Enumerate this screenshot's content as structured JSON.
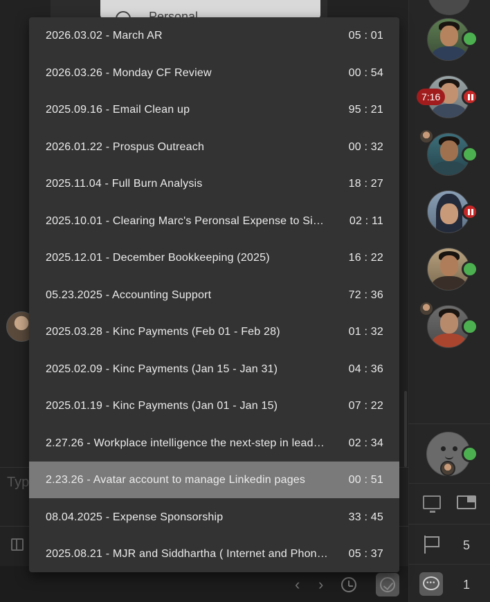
{
  "background": {
    "panel_peek_text": "Personal",
    "input_placeholder": "Type"
  },
  "sidebar": {
    "timer_badge": "7:16",
    "flag_count": "5",
    "chat_count": "1"
  },
  "dropdown": {
    "items": [
      {
        "title": "2026.03.02 - March AR",
        "time": "05 : 01"
      },
      {
        "title": "2026.03.26 - Monday CF Review",
        "time": "00 : 54"
      },
      {
        "title": "2025.09.16 - Email Clean up",
        "time": "95 : 21"
      },
      {
        "title": "2026.01.22 - Prospus Outreach",
        "time": "00 : 32"
      },
      {
        "title": "2025.11.04 - Full Burn Analysis",
        "time": "18 : 27"
      },
      {
        "title": "2025.10.01 - Clearing Marc's Peronsal Expense to Si…",
        "time": "02 : 11"
      },
      {
        "title": "2025.12.01 - December Bookkeeping (2025)",
        "time": "16 : 22"
      },
      {
        "title": "05.23.2025 - Accounting Support",
        "time": "72 : 36"
      },
      {
        "title": "2025.03.28 - Kinc Payments (Feb 01 - Feb 28)",
        "time": "01 : 32"
      },
      {
        "title": "2025.02.09 - Kinc Payments (Jan 15 - Jan 31)",
        "time": "04 : 36"
      },
      {
        "title": "2025.01.19 - Kinc Payments (Jan 01 - Jan 15)",
        "time": "07 : 22"
      },
      {
        "title": "2.27.26 - Workplace intelligence the next-step in lead…",
        "time": "02 : 34"
      },
      {
        "title": "2.23.26 - Avatar account to manage Linkedin pages",
        "time": "00 : 51",
        "selected": true
      },
      {
        "title": "08.04.2025 - Expense Sponsorship",
        "time": "33 : 45"
      },
      {
        "title": "2025.08.21 - MJR and Siddhartha ( Internet and Phon…",
        "time": "05 : 37"
      }
    ]
  },
  "colors": {
    "dropdown_bg": "#333333",
    "selected_row": "#7a7a7a",
    "online": "#4caf50",
    "paused": "#c62828"
  }
}
